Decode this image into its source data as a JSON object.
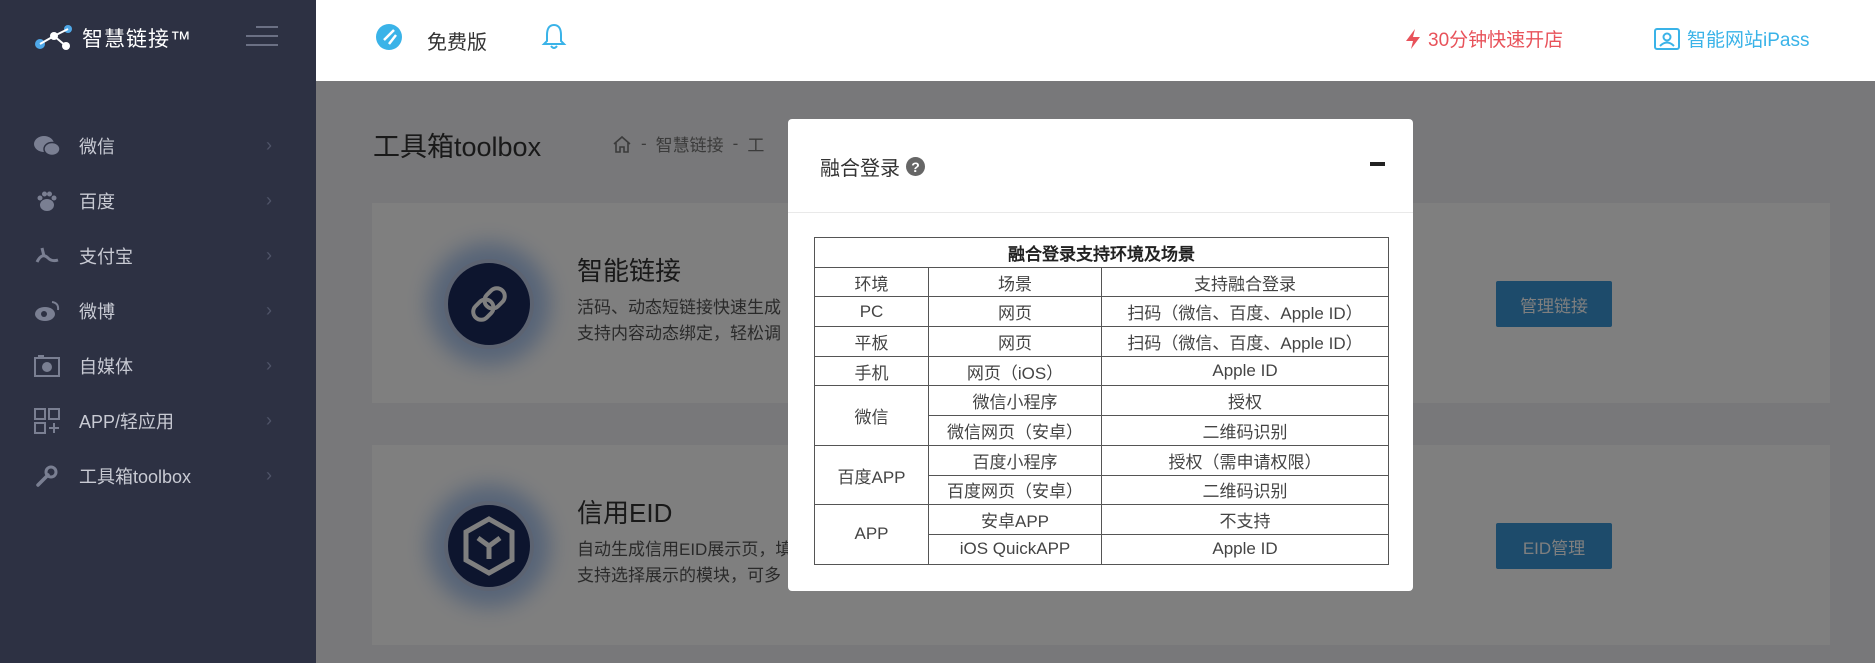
{
  "app": {
    "logo_text": "智慧链接™"
  },
  "sidebar": {
    "items": [
      {
        "label": "微信",
        "icon": "wechat-icon"
      },
      {
        "label": "百度",
        "icon": "baidu-paw-icon"
      },
      {
        "label": "支付宝",
        "icon": "alipay-icon"
      },
      {
        "label": "微博",
        "icon": "weibo-icon"
      },
      {
        "label": "自媒体",
        "icon": "media-icon"
      },
      {
        "label": "APP/轻应用",
        "icon": "app-grid-icon"
      },
      {
        "label": "工具箱toolbox",
        "icon": "wrench-icon"
      }
    ]
  },
  "topbar": {
    "plan_label": "免费版",
    "quick_open_label": "30分钟快速开店",
    "ipass_label": "智能网站iPass"
  },
  "page": {
    "title": "工具箱toolbox",
    "breadcrumb": [
      "智慧链接",
      "工"
    ]
  },
  "cards": [
    {
      "title": "智能链接",
      "desc_line1": "活码、动态短链接快速生成",
      "desc_line2": "支持内容动态绑定，轻松调",
      "button": "管理链接"
    },
    {
      "title": "信用EID",
      "desc_line1": "自动生成信用EID展示页，填",
      "desc_line2": "支持选择展示的模块，可多",
      "button": "EID管理"
    }
  ],
  "modal": {
    "title": "融合登录",
    "table_title": "融合登录支持环境及场景",
    "headers": [
      "环境",
      "场景",
      "支持融合登录"
    ],
    "rows": {
      "pc": {
        "env": "PC",
        "scene": "网页",
        "support": "扫码（微信、百度、Apple ID）"
      },
      "tablet": {
        "env": "平板",
        "scene": "网页",
        "support": "扫码（微信、百度、Apple ID）"
      },
      "phone": {
        "env": "手机",
        "scene": "网页（iOS）",
        "support": "Apple ID"
      },
      "wechat": {
        "env": "微信",
        "r1_scene": "微信小程序",
        "r1_support": "授权",
        "r2_scene": "微信网页（安卓）",
        "r2_support": "二维码识别"
      },
      "baidu": {
        "env": "百度APP",
        "r1_scene": "百度小程序",
        "r1_support": "授权（需申请权限）",
        "r2_scene": "百度网页（安卓）",
        "r2_support": "二维码识别"
      },
      "app": {
        "env": "APP",
        "r1_scene": "安卓APP",
        "r1_support": "不支持",
        "r2_scene": "iOS QuickAPP",
        "r2_support": "Apple ID"
      }
    }
  },
  "colors": {
    "sidebar_bg": "#2d3143",
    "accent_blue": "#3ab3e8",
    "accent_red": "#e8525a",
    "button_blue": "#3a97d6"
  }
}
